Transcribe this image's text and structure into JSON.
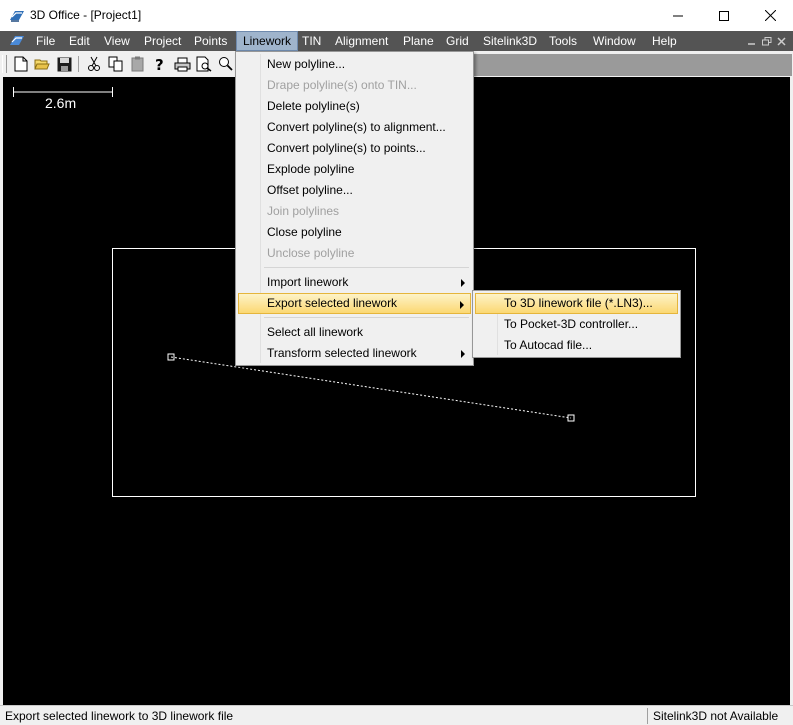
{
  "window": {
    "title": "3D Office - [Project1]",
    "icon": "app-logo-icon",
    "controls": [
      "minimize-icon",
      "maximize-icon",
      "close-icon"
    ]
  },
  "menubar": {
    "items": [
      "File",
      "Edit",
      "View",
      "Project",
      "Points",
      "Linework",
      "TIN",
      "Alignment",
      "Plane",
      "Grid",
      "Sitelink3D",
      "Tools",
      "Window",
      "Help"
    ],
    "active": "Linework"
  },
  "toolbar": {
    "buttons": [
      "new-icon",
      "open-icon",
      "save-icon",
      "cut-icon",
      "copy-icon",
      "paste-icon",
      "help-icon",
      "print-icon",
      "print-preview-icon",
      "zoom-icon"
    ]
  },
  "canvas": {
    "scale_label": "2.6m",
    "background": "#000000",
    "foreground": "#ffffff"
  },
  "linework_menu": {
    "items": [
      {
        "label": "New polyline...",
        "disabled": false
      },
      {
        "label": "Drape polyline(s) onto TIN...",
        "disabled": true
      },
      {
        "label": "Delete polyline(s)",
        "disabled": false
      },
      {
        "label": "Convert polyline(s) to alignment...",
        "disabled": false
      },
      {
        "label": "Convert polyline(s) to points...",
        "disabled": false
      },
      {
        "label": "Explode polyline",
        "disabled": false
      },
      {
        "label": "Offset polyline...",
        "disabled": false
      },
      {
        "label": "Join polylines",
        "disabled": true
      },
      {
        "label": "Close polyline",
        "disabled": false
      },
      {
        "label": "Unclose polyline",
        "disabled": true
      },
      {
        "label": "Import linework",
        "disabled": false,
        "submenu": true
      },
      {
        "label": "Export selected linework",
        "disabled": false,
        "submenu": true,
        "highlighted": true
      },
      {
        "label": "Select all linework",
        "disabled": false
      },
      {
        "label": "Transform selected linework",
        "disabled": false,
        "submenu": true
      }
    ]
  },
  "export_submenu": {
    "items": [
      {
        "label": "To 3D linework file (*.LN3)...",
        "highlighted": true
      },
      {
        "label": "To Pocket-3D controller..."
      },
      {
        "label": "To Autocad file..."
      }
    ]
  },
  "statusbar": {
    "message": "Export selected linework to 3D linework file",
    "sitelink_status": "Sitelink3D not Available"
  },
  "colors": {
    "menubar_bg": "#545454",
    "active_menu_bg": "#9fb4cc",
    "highlight_bg": "#fbd873"
  }
}
